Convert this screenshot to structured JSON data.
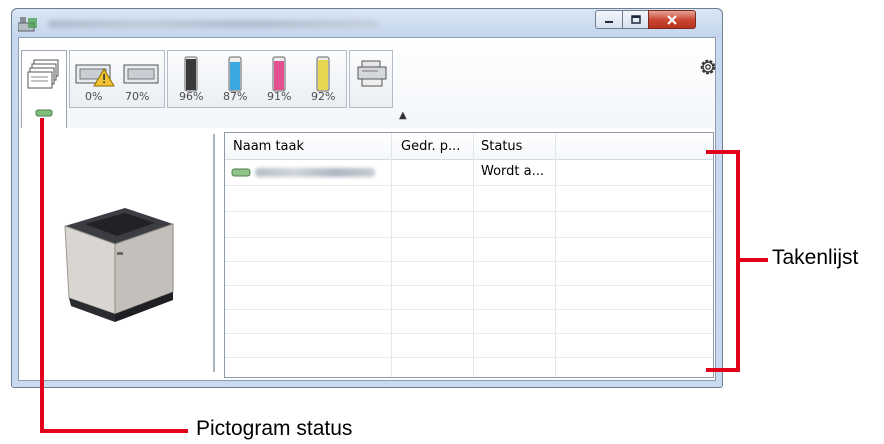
{
  "toolbar": {
    "tabs": [
      {
        "name": "job-list",
        "active": true
      },
      {
        "name": "paper-cassette-1",
        "level": "0%"
      },
      {
        "name": "paper-cassette-2",
        "level": "70%"
      },
      {
        "name": "toner-black",
        "level": "96%",
        "color": "#3a3a3a"
      },
      {
        "name": "toner-cyan",
        "level": "87%",
        "color": "#3aa9e0"
      },
      {
        "name": "toner-magenta",
        "level": "91%",
        "color": "#e3508f"
      },
      {
        "name": "toner-yellow",
        "level": "92%",
        "color": "#e7d650"
      },
      {
        "name": "printer-device"
      }
    ]
  },
  "joblist": {
    "columns": [
      "Naam taak",
      "Gedr. p...",
      "Status"
    ],
    "rows": [
      {
        "status": "Wordt a..."
      }
    ]
  },
  "callouts": {
    "right": "Takenlijst",
    "bottom": "Pictogram status"
  },
  "colors": {
    "accent_red": "#e3001b",
    "window_frame": "#c9daf0",
    "close_button": "#c7442f"
  }
}
